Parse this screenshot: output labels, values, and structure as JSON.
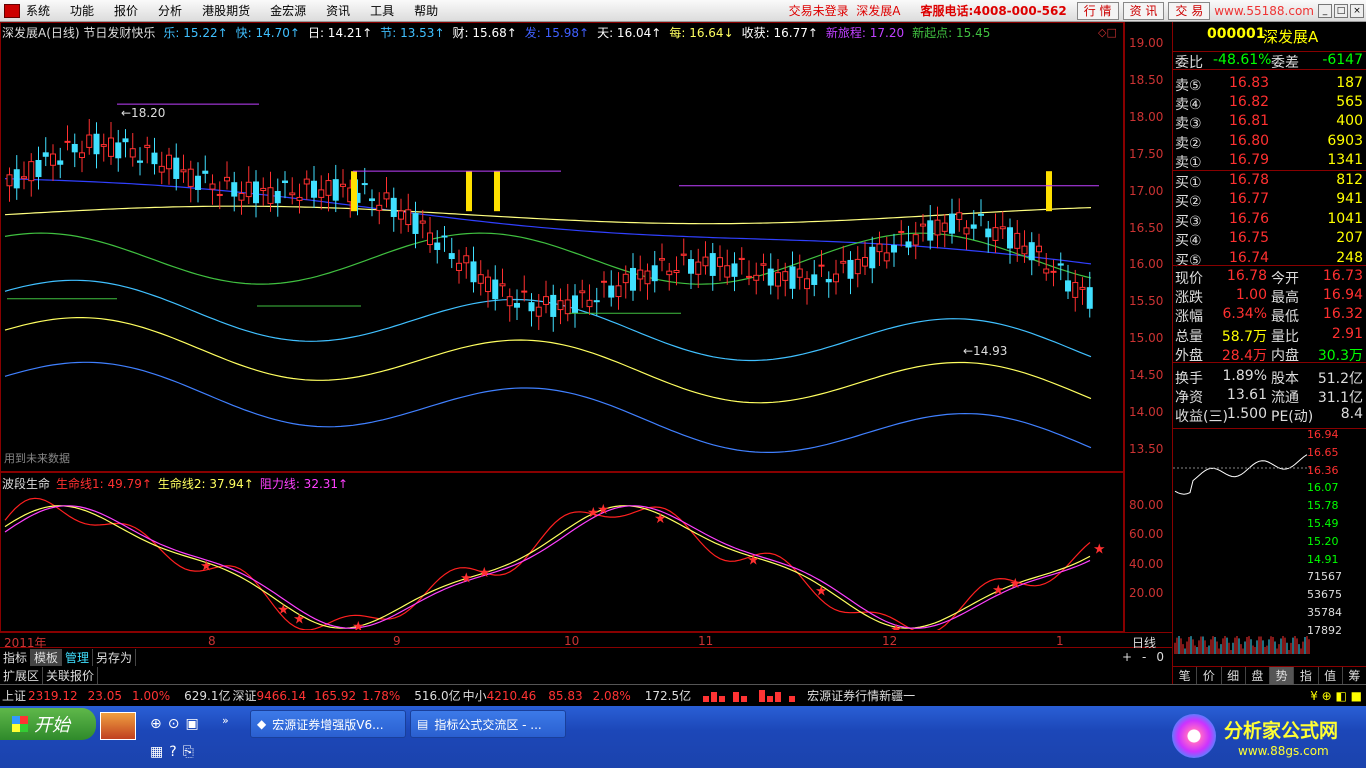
{
  "menubar": {
    "items": [
      "系统",
      "功能",
      "报价",
      "分析",
      "港股期货",
      "金宏源",
      "资讯",
      "工具",
      "帮助"
    ],
    "login_status": "交易未登录",
    "stock_name": "深发展A",
    "hotline": "客服电话:4008-000-562",
    "nav_buttons": [
      "行 情",
      "资 讯",
      "交 易"
    ],
    "brand_watermark": "www.55188.com"
  },
  "kline_header": [
    {
      "label": "深发展A(日线) 节日发财快乐",
      "color": "#dddddd"
    },
    {
      "label": "乐: 15.22↑",
      "color": "#40c0ff"
    },
    {
      "label": "快: 14.70↑",
      "color": "#40c0ff"
    },
    {
      "label": "日: 14.21↑",
      "color": "#ffffff"
    },
    {
      "label": "节: 13.53↑",
      "color": "#40c0ff"
    },
    {
      "label": "财: 15.68↑",
      "color": "#ffffff"
    },
    {
      "label": "发: 15.98↑",
      "color": "#4060ff"
    },
    {
      "label": "天: 16.04↑",
      "color": "#ffffff"
    },
    {
      "label": "每: 16.64↓",
      "color": "#ffff60"
    },
    {
      "label": "收获: 16.77↑",
      "color": "#ffffff"
    },
    {
      "label": "新旅程: 17.20",
      "color": "#c040ff"
    },
    {
      "label": "新起点: 15.45",
      "color": "#40c040"
    }
  ],
  "price_annotations": {
    "high": "18.20",
    "low": "14.93"
  },
  "kline_footer_note": "用到未来数据",
  "y_axis_main": [
    "19.00",
    "18.50",
    "18.00",
    "17.50",
    "17.00",
    "16.50",
    "16.00",
    "15.50",
    "15.00",
    "14.50",
    "14.00",
    "13.50"
  ],
  "sub_header": [
    {
      "label": "波段生命",
      "color": "#dddddd"
    },
    {
      "label": "生命线1: 49.79↑",
      "color": "#ff3030"
    },
    {
      "label": "生命线2: 37.94↑",
      "color": "#ffff60"
    },
    {
      "label": "阻力线: 32.31↑",
      "color": "#ff40ff"
    }
  ],
  "y_axis_sub": [
    "80.00",
    "60.00",
    "40.00",
    "20.00"
  ],
  "x_axis": [
    "2011年",
    "8",
    "9",
    "10",
    "11",
    "12",
    "1"
  ],
  "x_axis_right": "日线",
  "bottom_tabs": [
    "指标",
    "模板",
    "管理",
    "另存为"
  ],
  "bottom_tabs2": [
    "扩展区",
    "关联报价"
  ],
  "bottom_controls": [
    "+",
    "-",
    "0"
  ],
  "quote_panel": {
    "code": "000001",
    "name": "深发展A",
    "weibi_label": "委比",
    "weibi": "-48.61%",
    "weicha_label": "委差",
    "weicha": "-6147",
    "sells": [
      {
        "label": "卖⑤",
        "price": "16.83",
        "vol": "187"
      },
      {
        "label": "卖④",
        "price": "16.82",
        "vol": "565"
      },
      {
        "label": "卖③",
        "price": "16.81",
        "vol": "400"
      },
      {
        "label": "卖②",
        "price": "16.80",
        "vol": "6903"
      },
      {
        "label": "卖①",
        "price": "16.79",
        "vol": "1341"
      }
    ],
    "buys": [
      {
        "label": "买①",
        "price": "16.78",
        "vol": "812"
      },
      {
        "label": "买②",
        "price": "16.77",
        "vol": "941"
      },
      {
        "label": "买③",
        "price": "16.76",
        "vol": "1041"
      },
      {
        "label": "买④",
        "price": "16.75",
        "vol": "207"
      },
      {
        "label": "买⑤",
        "price": "16.74",
        "vol": "248"
      }
    ],
    "stats": [
      {
        "l1": "现价",
        "v1": "16.78",
        "l2": "今开",
        "v2": "16.73"
      },
      {
        "l1": "涨跌",
        "v1": "1.00",
        "l2": "最高",
        "v2": "16.94"
      },
      {
        "l1": "涨幅",
        "v1": "6.34%",
        "l2": "最低",
        "v2": "16.32"
      },
      {
        "l1": "总量",
        "v1": "58.7万",
        "l2": "量比",
        "v2": "2.91"
      },
      {
        "l1": "外盘",
        "v1": "28.4万",
        "l2": "内盘",
        "v2": "30.3万"
      },
      {
        "l1": "换手",
        "v1": "1.89%",
        "l2": "股本",
        "v2": "51.2亿"
      },
      {
        "l1": "净资",
        "v1": "13.61",
        "l2": "流通",
        "v2": "31.1亿"
      },
      {
        "l1": "收益(三)",
        "v1": "1.500",
        "l2": "PE(动)",
        "v2": "8.4"
      }
    ],
    "mini_axis": [
      "16.94",
      "16.65",
      "16.36",
      "16.07",
      "15.78",
      "15.49",
      "15.20",
      "14.91",
      "71567",
      "53675",
      "35784",
      "17892"
    ],
    "tabs": [
      "笔",
      "价",
      "细",
      "盘",
      "势",
      "指",
      "值",
      "筹"
    ]
  },
  "statusbar": {
    "sh_label": "上证",
    "sh_index": "2319.12",
    "sh_chg": "23.05",
    "sh_pct": "1.00%",
    "sh_amt": "629.1亿",
    "sz_label": "深证",
    "sz_index": "9466.14",
    "sz_chg": "165.92",
    "sz_pct": "1.78%",
    "sz_amt": "516.0亿",
    "zx_label": "中小",
    "zx_index": "4210.46",
    "zx_chg": "85.83",
    "zx_pct": "2.08%",
    "zx_amt": "172.5亿",
    "news": "宏源证券行情新疆一"
  },
  "taskbar": {
    "start": "开始",
    "items": [
      "宏源证券增强版V6...",
      "指标公式交流区 - ..."
    ],
    "watermark_title": "分析家公式网",
    "watermark_url": "www.88gs.com"
  },
  "colors": {
    "up": "#ff3030",
    "down": "#40e0ff",
    "axis": "#cc3333",
    "frame": "#880000"
  }
}
